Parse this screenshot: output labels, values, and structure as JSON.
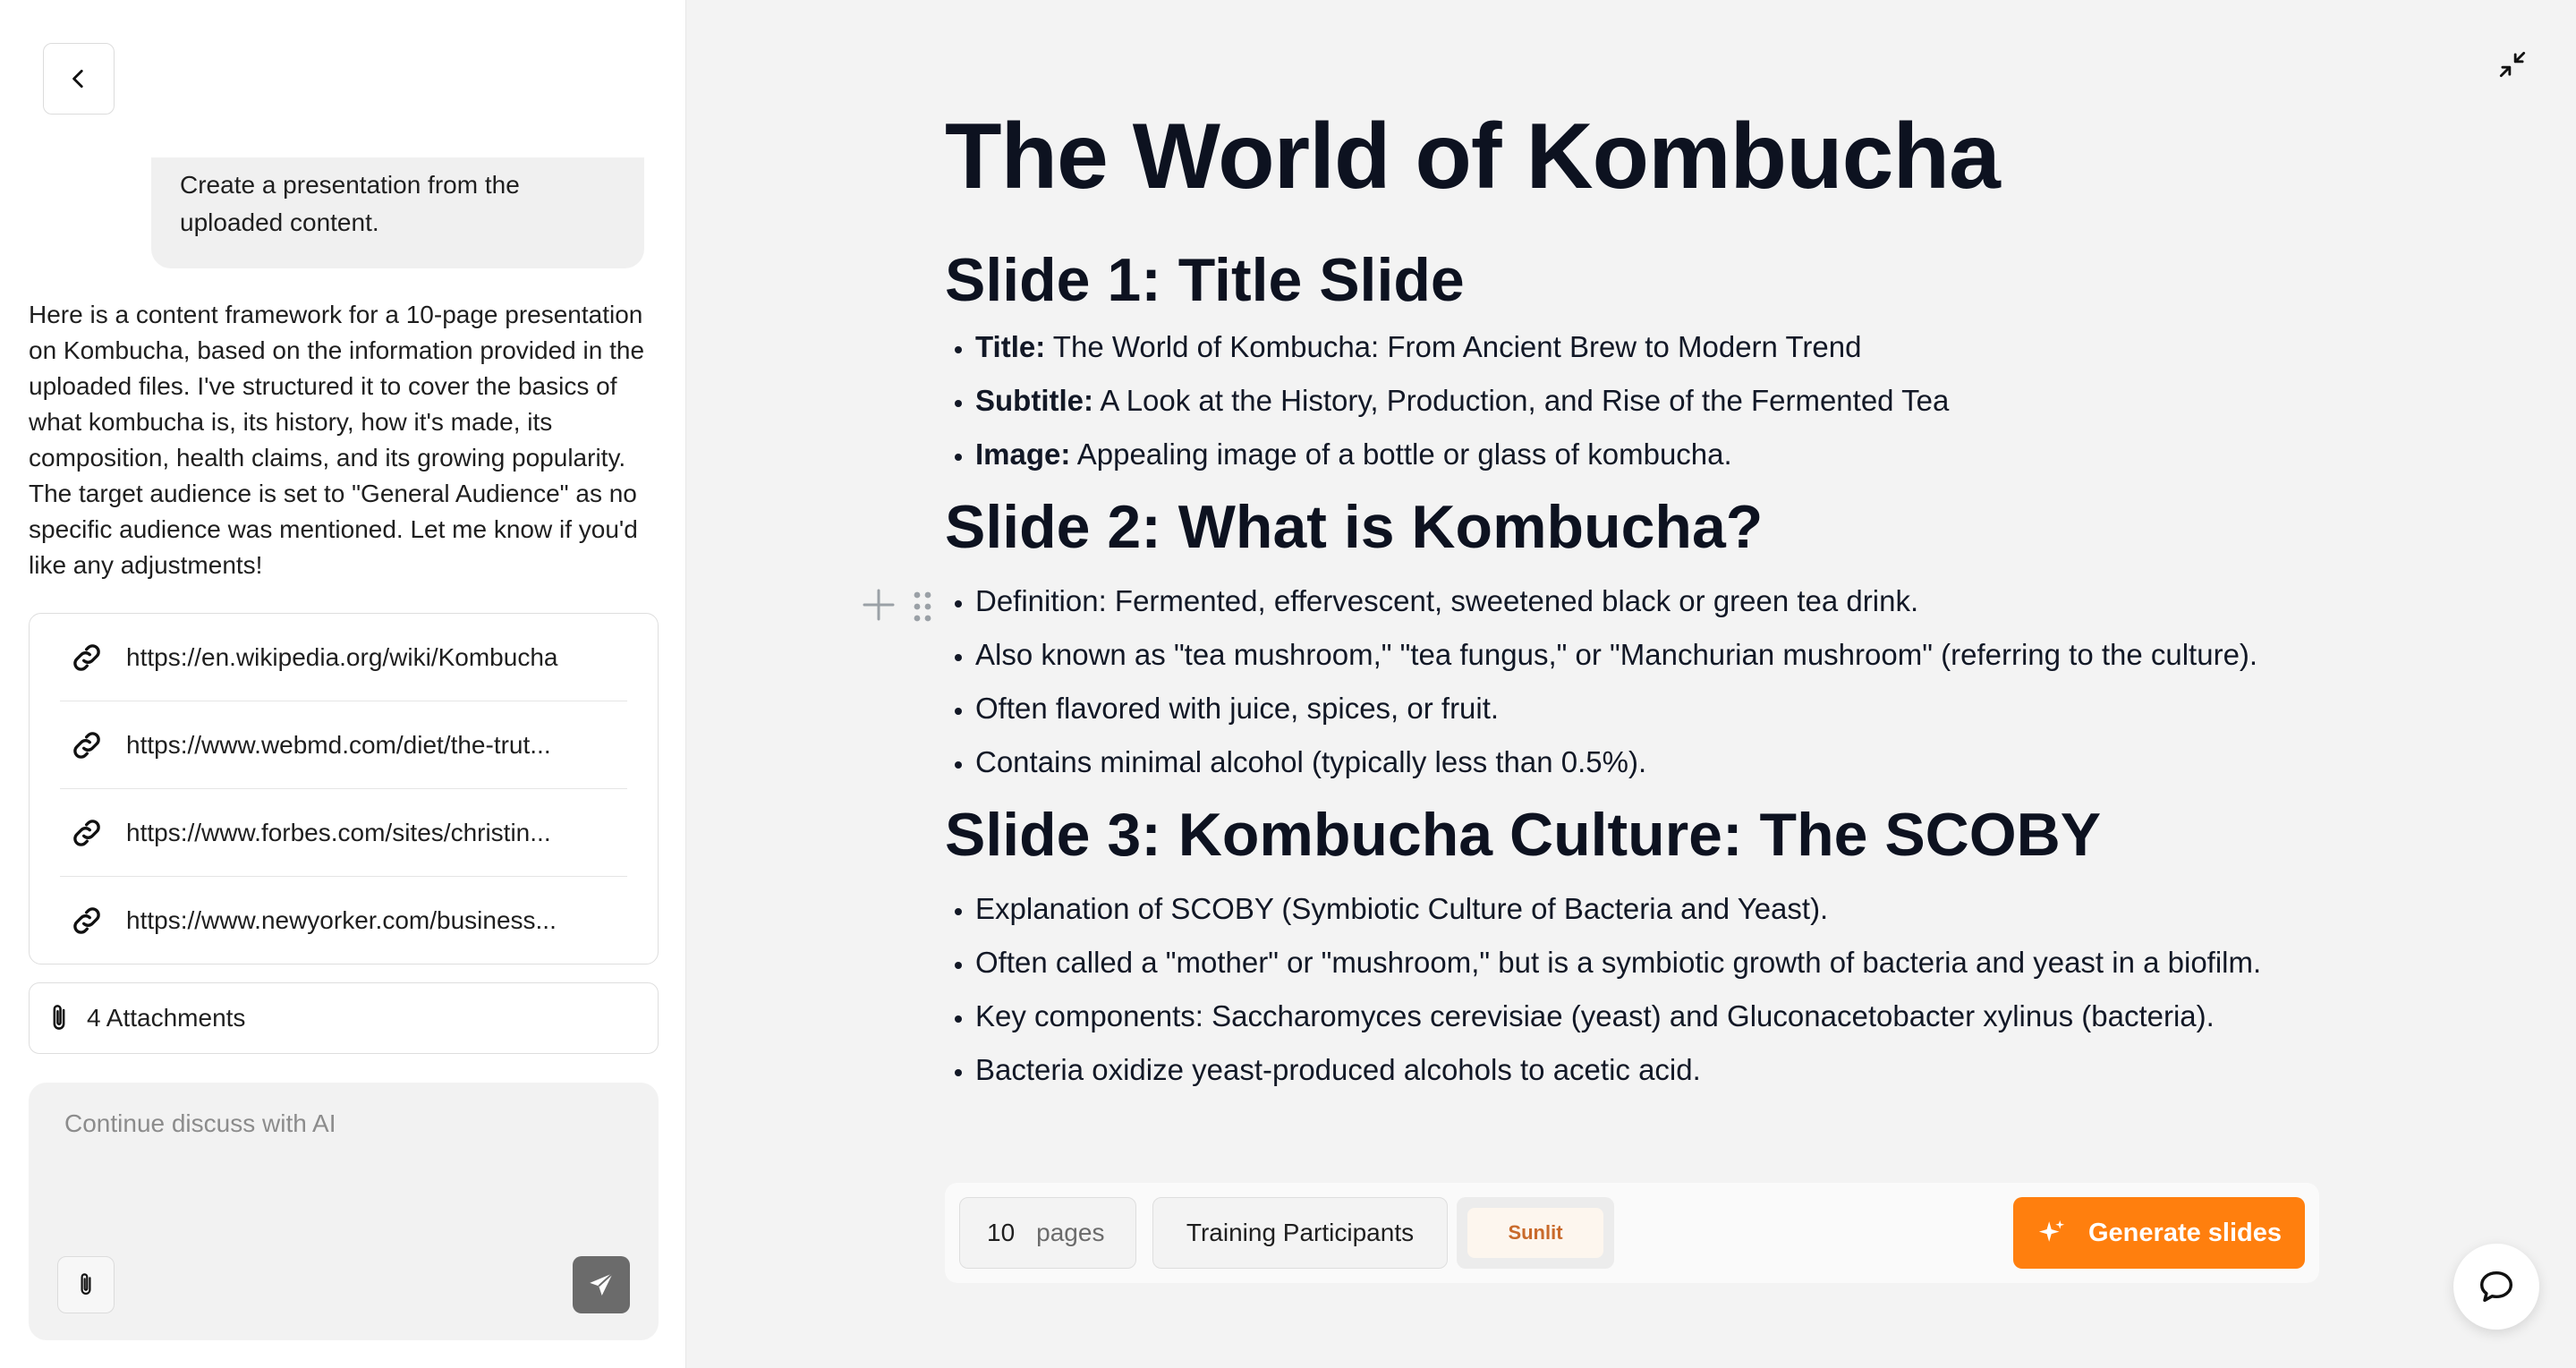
{
  "chat": {
    "user_message": "Create a presentation from the uploaded content.",
    "ai_message": "Here is a content framework for a 10-page presentation on Kombucha, based on the information provided in the uploaded files. I've structured it to cover the basics of what kombucha is, its history, how it's made, its composition, health claims, and its growing popularity. The target audience is set to \"General Audience\" as no specific audience was mentioned. Let me know if you'd like any adjustments!",
    "links": [
      {
        "url": "https://en.wikipedia.org/wiki/Kombucha",
        "icon": "link-icon"
      },
      {
        "url": "https://www.webmd.com/diet/the-trut...",
        "icon": "link-icon"
      },
      {
        "url": "https://www.forbes.com/sites/christin...",
        "icon": "link-icon"
      },
      {
        "url": "https://www.newyorker.com/business...",
        "icon": "link-icon"
      }
    ],
    "attachments_label": "4 Attachments",
    "input_placeholder": "Continue discuss with AI"
  },
  "document": {
    "title": "The World of Kombucha",
    "slides": [
      {
        "heading": "Slide 1: Title Slide",
        "bullets": [
          {
            "label": "Title:",
            "text": " The World of Kombucha: From Ancient Brew to Modern Trend"
          },
          {
            "label": "Subtitle:",
            "text": " A Look at the History, Production, and Rise of the Fermented Tea"
          },
          {
            "label": "Image:",
            "text": " Appealing image of a bottle or glass of kombucha."
          }
        ]
      },
      {
        "heading": "Slide 2: What is Kombucha?",
        "bullets": [
          {
            "text": "Definition: Fermented, effervescent, sweetened black or green tea drink."
          },
          {
            "text": "Also known as \"tea mushroom,\" \"tea fungus,\" or \"Manchurian mushroom\" (referring to the culture)."
          },
          {
            "text": "Often flavored with juice, spices, or fruit."
          },
          {
            "text": "Contains minimal alcohol (typically less than 0.5%)."
          }
        ]
      },
      {
        "heading": "Slide 3: Kombucha Culture: The SCOBY",
        "bullets": [
          {
            "text": "Explanation of SCOBY (Symbiotic Culture of Bacteria and Yeast)."
          },
          {
            "text": "Often called a \"mother\" or \"mushroom,\" but is a symbiotic growth of bacteria and yeast in a biofilm."
          },
          {
            "text": "Key components: Saccharomyces cerevisiae (yeast) and Gluconacetobacter xylinus (bacteria)."
          },
          {
            "text": "Bacteria oxidize yeast-produced alcohols to acetic acid."
          }
        ]
      }
    ]
  },
  "toolbar": {
    "pages_count": "10",
    "pages_unit": "pages",
    "audience": "Training Participants",
    "theme": "Sunlit",
    "generate_label": "Generate slides"
  },
  "colors": {
    "accent": "#ff7f0e",
    "theme_chip_text": "#c96a2b",
    "heading": "#0d1220"
  }
}
